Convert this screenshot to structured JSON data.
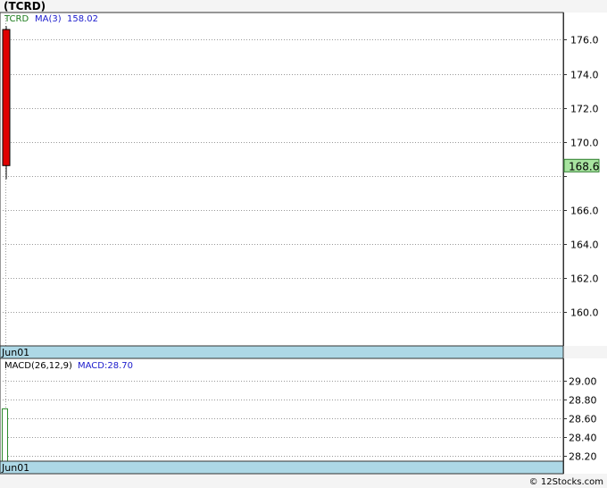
{
  "chart_data": [
    {
      "type": "candlestick",
      "title": "(TCRD)",
      "legend": [
        {
          "label": "TCRD",
          "color": "#1a7a1a"
        },
        {
          "label": "MA(3)",
          "color": "#1a1acc"
        },
        {
          "label": "158.02",
          "color": "#1a1acc"
        }
      ],
      "ylim": [
        158.0,
        177.6
      ],
      "yticks": [
        160.0,
        162.0,
        164.0,
        166.0,
        168.0,
        170.0,
        172.0,
        174.0,
        176.0
      ],
      "ytick_labels": [
        "160.0",
        "162.0",
        "164.0",
        "166.0",
        "",
        "170.0",
        "172.0",
        "174.0",
        "176.0"
      ],
      "x_label": "Jun01",
      "candles": [
        {
          "open": 176.6,
          "high": 176.8,
          "low": 167.8,
          "close": 168.6,
          "color": "#e00000"
        }
      ],
      "last_price": {
        "value": 168.6,
        "label": "168.6",
        "color": "#a8e4a0"
      },
      "grid": true
    },
    {
      "type": "bar",
      "legend": [
        {
          "label": "MACD(26,12,9)",
          "color": "#000000"
        },
        {
          "label": "MACD:28.70",
          "color": "#1a1acc"
        }
      ],
      "ylim": [
        28.14,
        29.24
      ],
      "yticks": [
        28.2,
        28.4,
        28.6,
        28.8,
        29.0
      ],
      "ytick_labels": [
        "28.20",
        "28.40",
        "28.60",
        "28.80",
        "29.00"
      ],
      "x_label": "Jun01",
      "values": [
        28.7
      ],
      "bar_color": "#2e8b2e",
      "grid": true
    }
  ],
  "footer": "© 12Stocks.com"
}
